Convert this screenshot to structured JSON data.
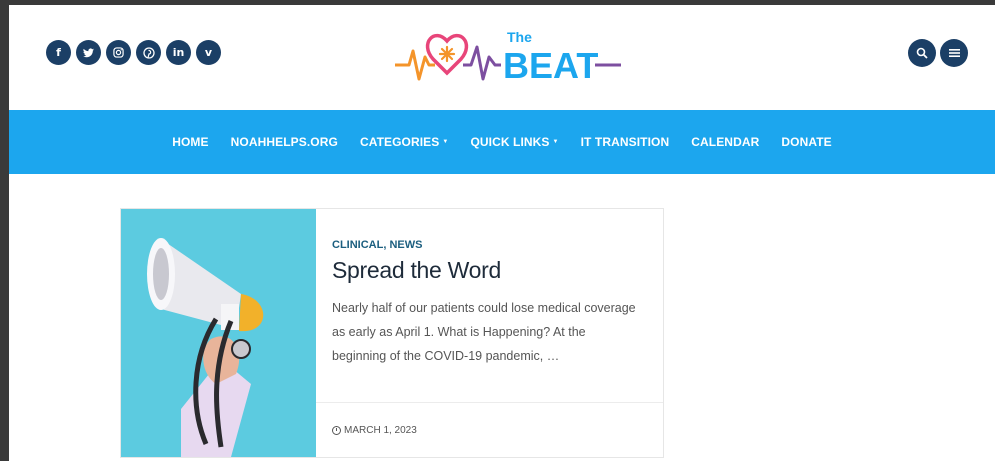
{
  "social": [
    {
      "name": "facebook",
      "glyph": "f"
    },
    {
      "name": "twitter",
      "glyph": "t"
    },
    {
      "name": "instagram",
      "glyph": "◎"
    },
    {
      "name": "pinterest",
      "glyph": "p"
    },
    {
      "name": "linkedin",
      "glyph": "in"
    },
    {
      "name": "vimeo",
      "glyph": "v"
    }
  ],
  "logo": {
    "small": "The",
    "big": "BEAT"
  },
  "colors": {
    "nav_bg": "#1ca6ee",
    "icon_bg": "#1b3f66",
    "logo_orange": "#f4942a",
    "logo_purple": "#7d4fa0",
    "logo_blue": "#1ca6ee"
  },
  "nav": {
    "home": "HOME",
    "noahhelps": "NOAHHELPS.ORG",
    "categories": "CATEGORIES",
    "quick_links": "QUICK LINKS",
    "it_transition": "IT TRANSITION",
    "calendar": "CALENDAR",
    "donate": "DONATE"
  },
  "post": {
    "categories": "CLINICAL, NEWS",
    "title": "Spread the Word",
    "excerpt": "Nearly half of our patients could lose medical coverage as early as April 1. What is Happening? At the beginning of the COVID-19 pandemic, …",
    "date": "MARCH 1, 2023"
  }
}
